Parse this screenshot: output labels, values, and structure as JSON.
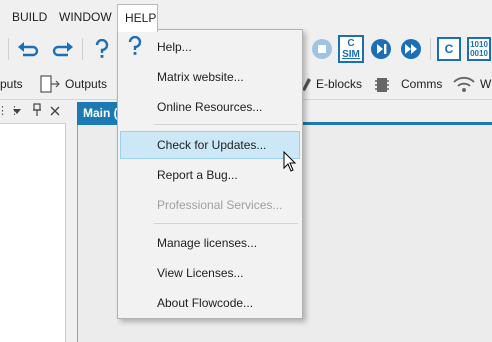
{
  "menubar": {
    "items": [
      {
        "label": "BUILD"
      },
      {
        "label": "WINDOW"
      },
      {
        "label": "HELP"
      }
    ]
  },
  "toolbar": {
    "sim_label_top": "C",
    "sim_label_bottom": "SIM",
    "code_label": "C",
    "binary_label_top": "1010",
    "binary_label_bottom": "0010"
  },
  "toolbar2": {
    "inputs_label": "puts",
    "outputs_label": "Outputs",
    "eblocks_label": "E-blocks",
    "comms_label": "Comms",
    "wireless_label": "W"
  },
  "main_tab": {
    "label": "Main ("
  },
  "help_menu": {
    "items": [
      {
        "label": "Help...",
        "state": "normal"
      },
      {
        "label": "Matrix website...",
        "state": "normal"
      },
      {
        "label": "Online Resources...",
        "state": "normal"
      },
      {
        "label": "Check for Updates...",
        "state": "hover"
      },
      {
        "label": "Report a Bug...",
        "state": "normal"
      },
      {
        "label": "Professional Services...",
        "state": "disabled"
      },
      {
        "label": "Manage licenses...",
        "state": "normal"
      },
      {
        "label": "View Licenses...",
        "state": "normal"
      },
      {
        "label": "About Flowcode...",
        "state": "normal"
      }
    ]
  },
  "colors": {
    "accent": "#1b7ab3",
    "icon_blue": "#1a6fb5",
    "hover_bg": "#cce8f7"
  }
}
